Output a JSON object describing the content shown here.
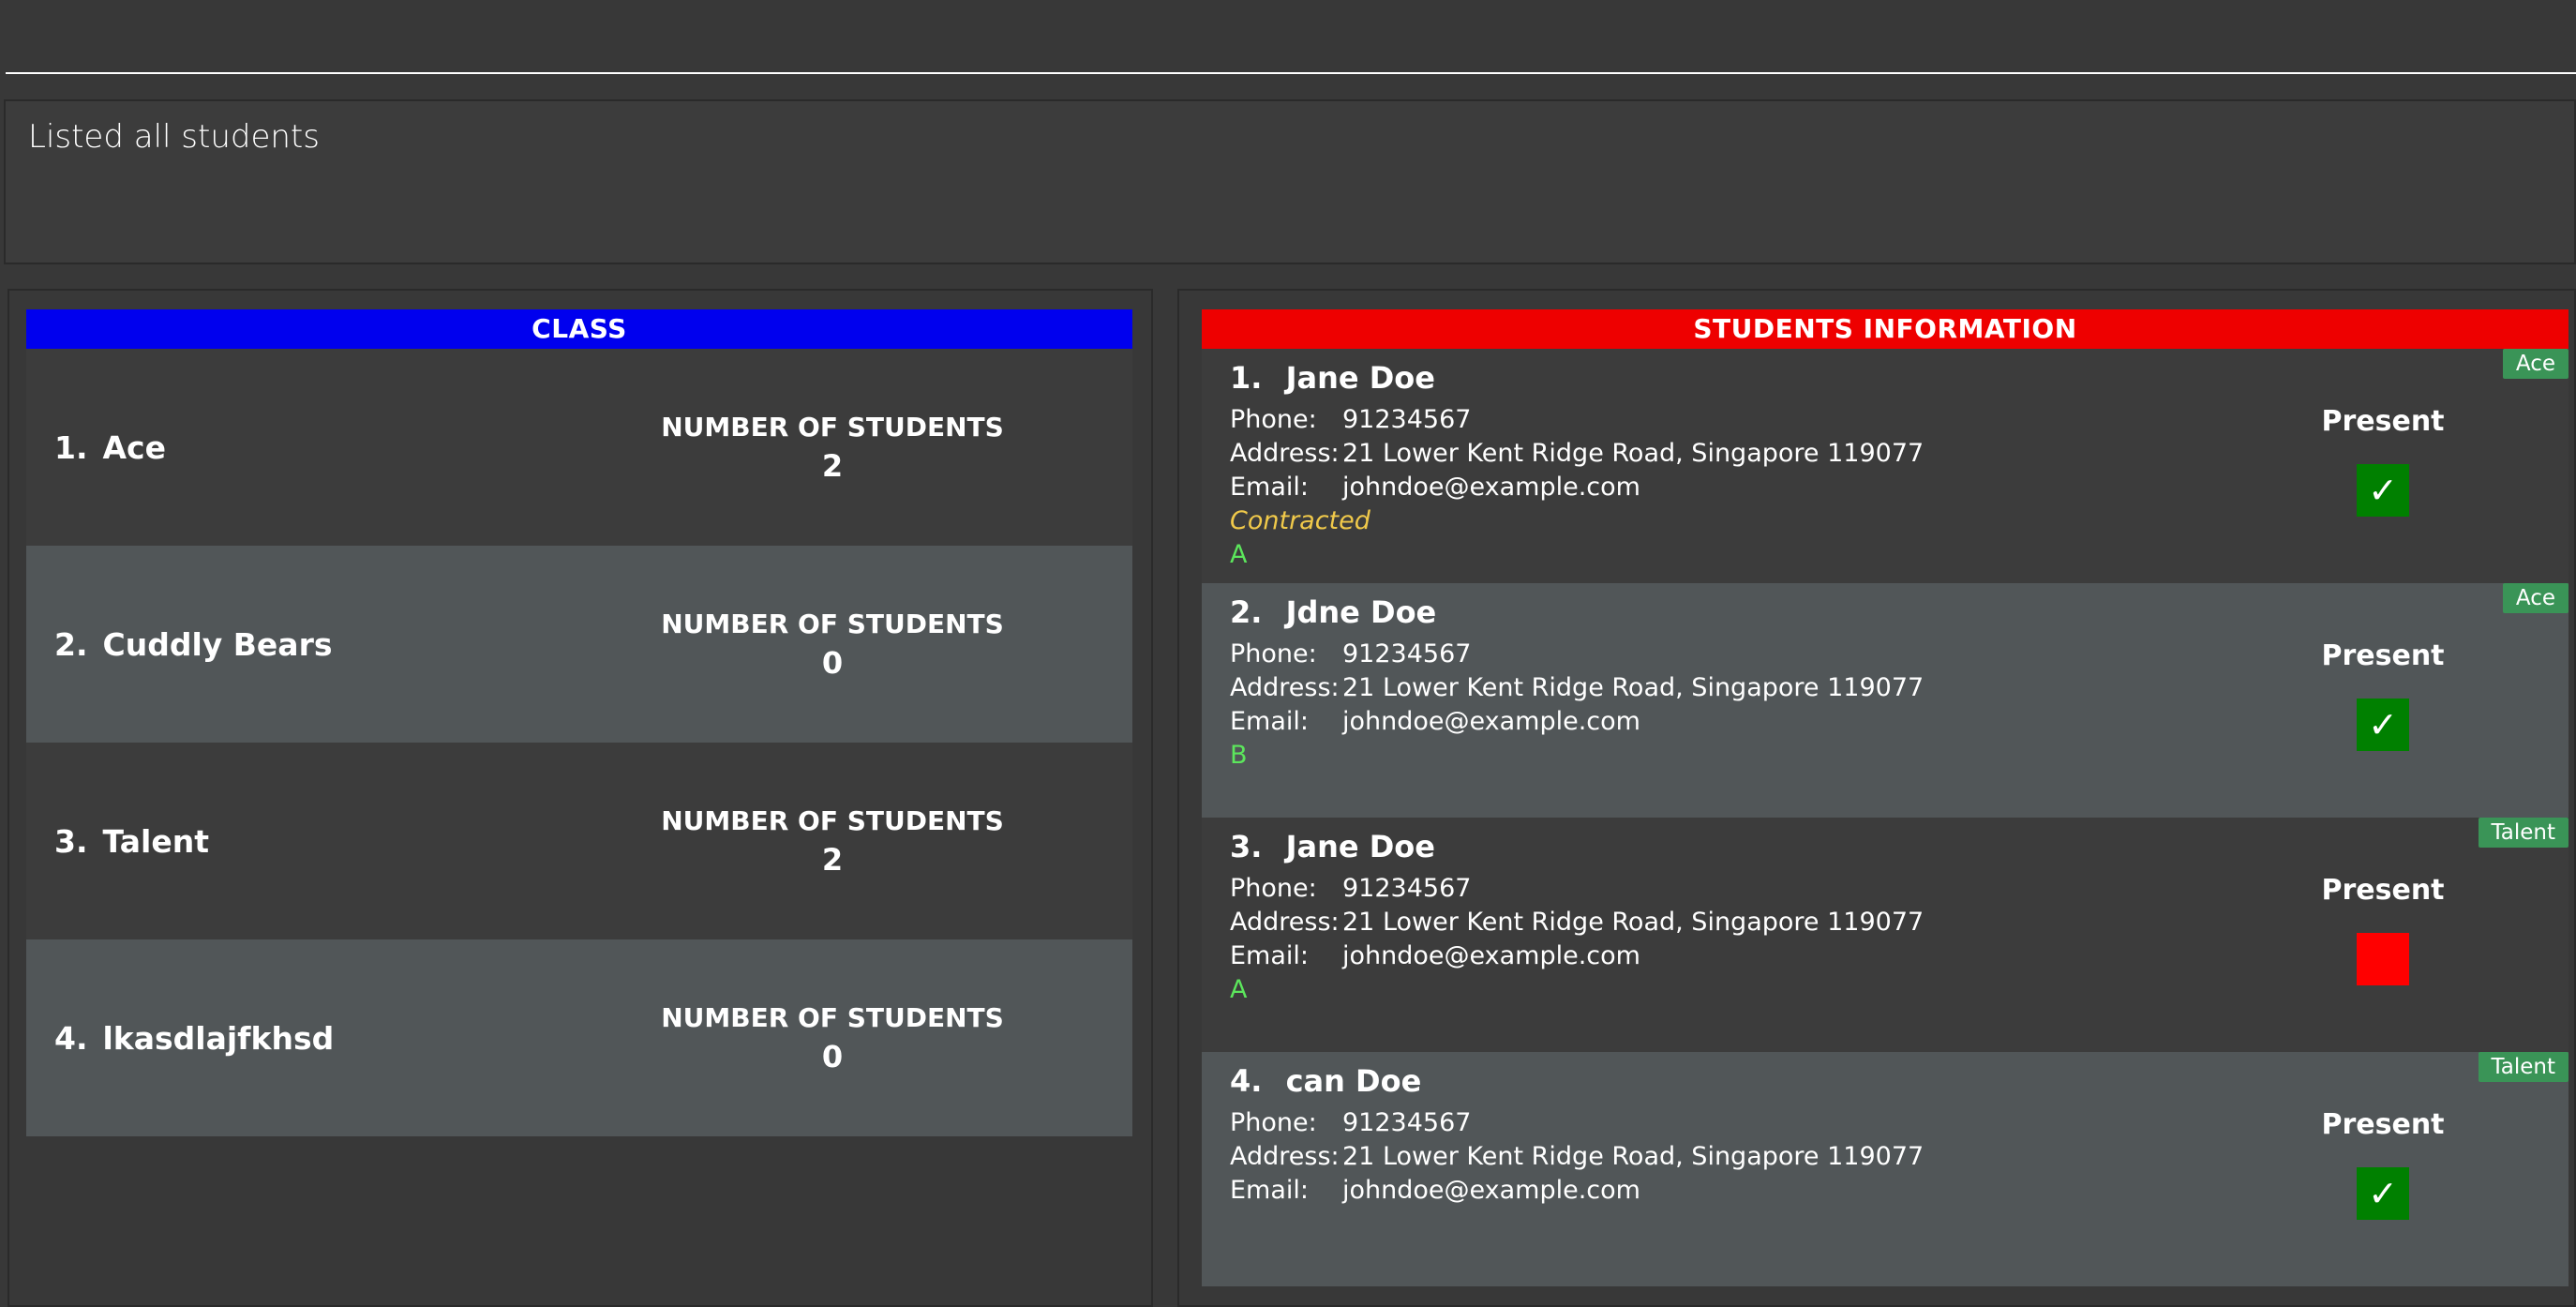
{
  "result": {
    "message": "Listed all students"
  },
  "class_panel": {
    "header": "CLASS",
    "header_color": "#0000ee",
    "count_label": "NUMBER OF STUDENTS",
    "classes": [
      {
        "index": "1.",
        "name": "Ace",
        "count": "2"
      },
      {
        "index": "2.",
        "name": "Cuddly Bears",
        "count": "0"
      },
      {
        "index": "3.",
        "name": "Talent",
        "count": "2"
      },
      {
        "index": "4.",
        "name": "lkasdlajfkhsd",
        "count": "0"
      }
    ]
  },
  "student_panel": {
    "header": "STUDENTS INFORMATION",
    "header_color": "#ee0000",
    "present_label": "Present",
    "field_labels": {
      "phone": "Phone:",
      "address": "Address:",
      "email": "Email:"
    },
    "students": [
      {
        "index": "1.",
        "name": "Jane Doe",
        "phone": "91234567",
        "address": "21 Lower Kent Ridge Road, Singapore 119077",
        "email": "johndoe@example.com",
        "contracted": "Contracted",
        "grade": "A",
        "tag": "Ace",
        "present": true,
        "attend_color": "#008000",
        "attend_icon": "checkmark-icon"
      },
      {
        "index": "2.",
        "name": "Jdne Doe",
        "phone": "91234567",
        "address": "21 Lower Kent Ridge Road, Singapore 119077",
        "email": "johndoe@example.com",
        "contracted": "",
        "grade": "B",
        "tag": "Ace",
        "present": true,
        "attend_color": "#008000",
        "attend_icon": "checkmark-icon"
      },
      {
        "index": "3.",
        "name": "Jane Doe",
        "phone": "91234567",
        "address": "21 Lower Kent Ridge Road, Singapore 119077",
        "email": "johndoe@example.com",
        "contracted": "",
        "grade": "A",
        "tag": "Talent",
        "present": false,
        "attend_color": "#ff0000",
        "attend_icon": ""
      },
      {
        "index": "4.",
        "name": "can Doe",
        "phone": "91234567",
        "address": "21 Lower Kent Ridge Road, Singapore 119077",
        "email": "johndoe@example.com",
        "contracted": "",
        "grade": "",
        "tag": "Talent",
        "present": true,
        "attend_color": "#008000",
        "attend_icon": "checkmark-icon"
      }
    ]
  }
}
